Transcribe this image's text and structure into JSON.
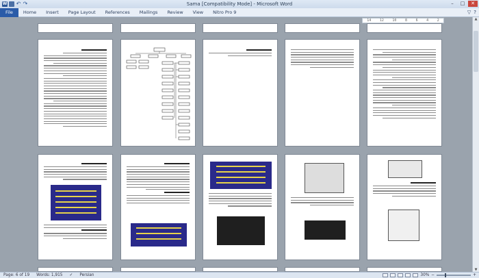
{
  "window": {
    "title": "Sama [Compatibility Mode] - Microsoft Word"
  },
  "quick_access": {
    "word_icon": "W",
    "save_icon": "save-icon",
    "undo_icon": "↶",
    "redo_icon": "↷"
  },
  "window_controls": {
    "minimize": "–",
    "maximize": "□",
    "close": "✕"
  },
  "ribbon": {
    "file_tab": "File",
    "tabs": [
      "Home",
      "Insert",
      "Page Layout",
      "References",
      "Mailings",
      "Review",
      "View",
      "Nitro Pro 9"
    ],
    "right_icons": [
      "▽",
      "?"
    ]
  },
  "ruler": {
    "ticks": [
      "14",
      "12",
      "10",
      "8",
      "6",
      "4",
      "2"
    ]
  },
  "status": {
    "page": "Page: 6 of 19",
    "words": "Words: 1,915",
    "language": "Persian",
    "zoom": "30%"
  },
  "colors": {
    "file_tab": "#2a5ba8",
    "doc_background": "#9aa3ad",
    "blue_image": "#2a2a8a"
  }
}
